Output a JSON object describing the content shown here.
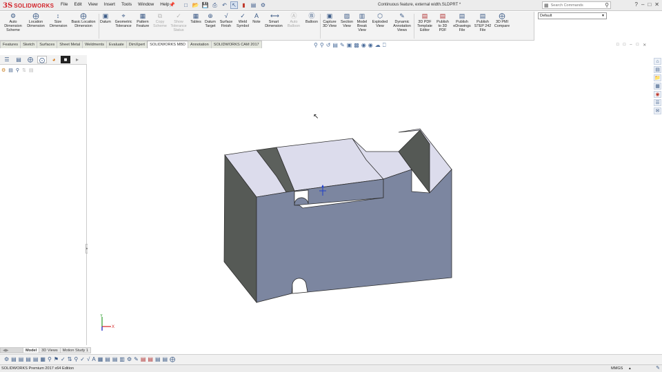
{
  "app": {
    "logo_mark": "3S",
    "logo_text": "SOLIDWORKS",
    "document_title": "Continuous feature, external width.SLDPRT *"
  },
  "menus": [
    "File",
    "Edit",
    "View",
    "Insert",
    "Tools",
    "Window",
    "Help"
  ],
  "search": {
    "placeholder": "Search Commands"
  },
  "window_controls": [
    "?",
    "–",
    "□",
    "✕"
  ],
  "configuration": {
    "selected": "Default"
  },
  "ribbon": {
    "buttons": [
      {
        "label": "Auto\nDimension\nScheme",
        "icon": "auto-dimension-icon",
        "enabled": true
      },
      {
        "label": "Location\nDimension",
        "icon": "location-dimension-icon",
        "enabled": true
      },
      {
        "label": "Size\nDimension",
        "icon": "size-dimension-icon",
        "enabled": true
      },
      {
        "label": "Basic Location\nDimension",
        "icon": "basic-location-icon",
        "enabled": true
      },
      {
        "label": "Datum",
        "icon": "datum-icon",
        "enabled": true
      },
      {
        "label": "Geometric\nTolerance",
        "icon": "geometric-tolerance-icon",
        "enabled": true
      },
      {
        "label": "Pattern\nFeature",
        "icon": "pattern-feature-icon",
        "enabled": true
      },
      {
        "label": "Copy\nScheme",
        "icon": "copy-scheme-icon",
        "enabled": false
      },
      {
        "label": "Show\nTolerance\nStatus",
        "icon": "tolerance-status-icon",
        "enabled": false
      },
      {
        "label": "Tables",
        "icon": "tables-icon",
        "enabled": true
      },
      {
        "label": "Datum\nTarget",
        "icon": "datum-target-icon",
        "enabled": true
      },
      {
        "label": "Surface\nFinish",
        "icon": "surface-finish-icon",
        "enabled": true
      },
      {
        "label": "Weld\nSymbol",
        "icon": "weld-symbol-icon",
        "enabled": true
      },
      {
        "label": "Note",
        "icon": "note-icon",
        "enabled": true
      },
      {
        "label": "Smart\nDimension",
        "icon": "smart-dimension-icon",
        "enabled": true
      },
      {
        "label": "Auto\nBalloon",
        "icon": "auto-balloon-icon",
        "enabled": false
      },
      {
        "label": "Balloon",
        "icon": "balloon-icon",
        "enabled": true
      },
      {
        "label": "Capture\n3D View",
        "icon": "capture-3d-view-icon",
        "enabled": true
      },
      {
        "label": "Section\nView",
        "icon": "section-view-icon",
        "enabled": true
      },
      {
        "label": "Model\nBreak\nView",
        "icon": "model-break-view-icon",
        "enabled": true
      },
      {
        "label": "Exploded\nView",
        "icon": "exploded-view-icon",
        "enabled": true
      },
      {
        "label": "Dynamic\nAnnotation\nViews",
        "icon": "dynamic-annotation-icon",
        "enabled": true
      },
      {
        "label": "3D PDF\nTemplate\nEditor",
        "icon": "pdf-template-icon",
        "enabled": true
      },
      {
        "label": "Publish\nto 3D\nPDF",
        "icon": "publish-3d-pdf-icon",
        "enabled": true
      },
      {
        "label": "Publish\neDrawings\nFile",
        "icon": "publish-edrawings-icon",
        "enabled": true
      },
      {
        "label": "Publish\nSTEP 242\nFile",
        "icon": "publish-step-icon",
        "enabled": true
      },
      {
        "label": "3D PMI\nCompare",
        "icon": "pmi-compare-icon",
        "enabled": true
      }
    ]
  },
  "tabs": [
    {
      "label": "Features",
      "active": false
    },
    {
      "label": "Sketch",
      "active": false
    },
    {
      "label": "Surfaces",
      "active": false
    },
    {
      "label": "Sheet Metal",
      "active": false
    },
    {
      "label": "Weldments",
      "active": false
    },
    {
      "label": "Evaluate",
      "active": false
    },
    {
      "label": "DimXpert",
      "active": false
    },
    {
      "label": "SOLIDWORKS MBD",
      "active": true
    },
    {
      "label": "Annotation",
      "active": false
    },
    {
      "label": "SOLIDWORKS CAM 2017",
      "active": false
    }
  ],
  "bottom_tabs": [
    {
      "label": "Model",
      "active": true
    },
    {
      "label": "3D Views",
      "active": false
    },
    {
      "label": "Motion Study 1",
      "active": false
    }
  ],
  "triad": {
    "x_label": "X",
    "y_label": "Y"
  },
  "status": {
    "edition": "SOLIDWORKS Premium 2017 x64 Edition",
    "units": "MMGS",
    "units_arrow": "▴"
  },
  "colors": {
    "model_front": "#7c86a0",
    "model_top": "#dcdcec",
    "model_side": "#565a56",
    "brand_red": "#d2232a"
  }
}
